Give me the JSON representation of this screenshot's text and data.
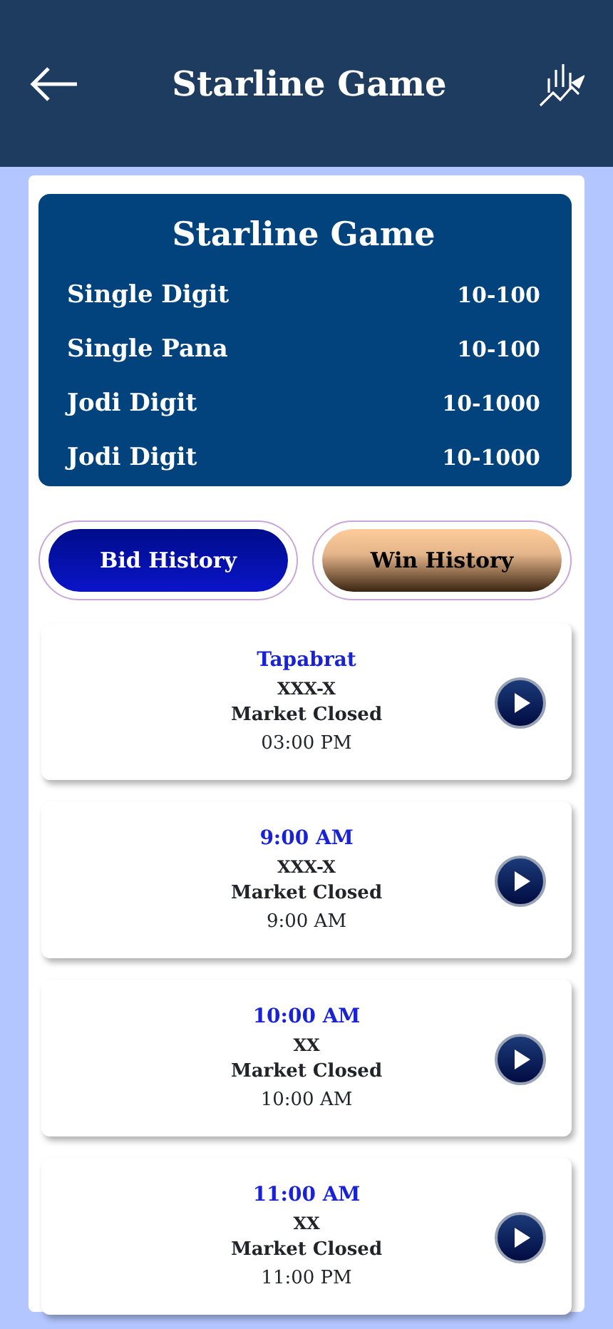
{
  "header": {
    "title": "Starline Game"
  },
  "rates": {
    "title": "Starline Game",
    "rows": [
      {
        "label": "Single Digit",
        "value": "10-100"
      },
      {
        "label": "Single Pana",
        "value": "10-100"
      },
      {
        "label": "Jodi Digit",
        "value": "10-1000"
      },
      {
        "label": "Jodi Digit",
        "value": "10-1000"
      }
    ]
  },
  "buttons": [
    {
      "label": "Bid History",
      "kind": "blue"
    },
    {
      "label": "Win History",
      "kind": "bronze"
    }
  ],
  "markets": [
    {
      "name": "Tapabrat",
      "result": "XXX-X",
      "status": "Market Closed",
      "time": "03:00 PM"
    },
    {
      "name": "9:00 AM",
      "result": "XXX-X",
      "status": "Market Closed",
      "time": "9:00 AM"
    },
    {
      "name": "10:00 AM",
      "result": "XX",
      "status": "Market Closed",
      "time": "10:00 AM"
    },
    {
      "name": "11:00 AM",
      "result": "XX",
      "status": "Market Closed",
      "time": "11:00 PM"
    }
  ]
}
